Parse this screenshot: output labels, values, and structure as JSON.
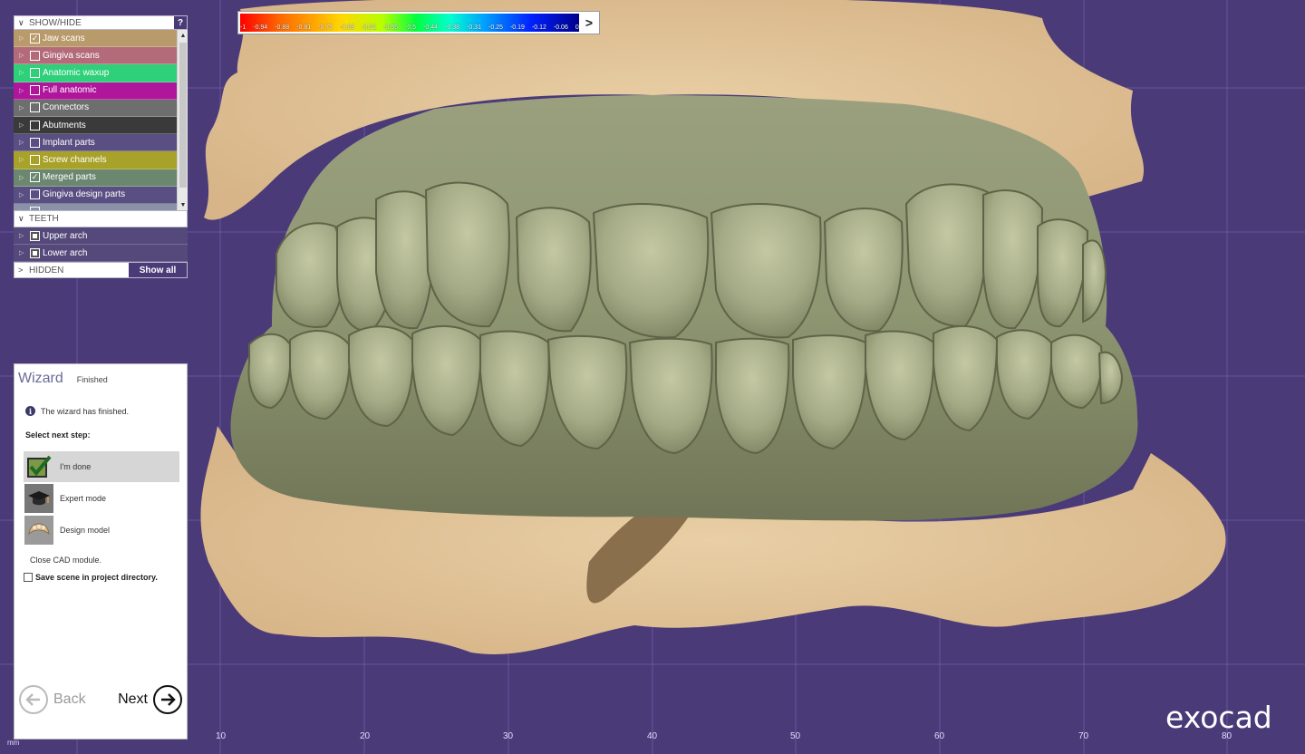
{
  "colorbar": {
    "ticks": [
      "-1",
      "-0.94",
      "-0.88",
      "-0.81",
      "-0.75",
      "-0.69",
      "-0.62",
      "-0.56",
      "-0.5",
      "-0.44",
      "-0.38",
      "-0.31",
      "-0.25",
      "-0.19",
      "-0.12",
      "-0.06",
      "0"
    ],
    "arrow": ">"
  },
  "show_hide": {
    "title": "SHOW/HIDE",
    "help": "?",
    "items": [
      {
        "label": "Jaw scans",
        "checked": true,
        "color": "#b99a6b"
      },
      {
        "label": "Gingiva scans",
        "checked": false,
        "color": "#b36b7a"
      },
      {
        "label": "Anatomic waxup",
        "checked": false,
        "color": "#2fd07a"
      },
      {
        "label": "Full anatomic",
        "checked": false,
        "color": "#b0169c"
      },
      {
        "label": "Connectors",
        "checked": false,
        "color": "#6e6e6e"
      },
      {
        "label": "Abutments",
        "checked": false,
        "color": "#3a3a3a"
      },
      {
        "label": "Implant parts",
        "checked": false,
        "color": "#5a4f82"
      },
      {
        "label": "Screw channels",
        "checked": false,
        "color": "#a8a22a"
      },
      {
        "label": "Merged parts",
        "checked": true,
        "color": "#6c8770"
      },
      {
        "label": "Gingiva design parts",
        "checked": false,
        "color": "#5a4f82"
      },
      {
        "label": "",
        "checked": false,
        "color": "#8a92a8"
      }
    ]
  },
  "teeth": {
    "title": "TEETH",
    "items": [
      {
        "label": "Upper arch"
      },
      {
        "label": "Lower arch"
      }
    ]
  },
  "hidden": {
    "title": "HIDDEN",
    "show_all": "Show all"
  },
  "wizard": {
    "title": "Wizard",
    "status": "Finished",
    "info": "The wizard has finished.",
    "select_label": "Select next step:",
    "options": [
      {
        "label": "I'm done",
        "icon": "checkmark-icon",
        "selected": true
      },
      {
        "label": "Expert mode",
        "icon": "graduation-cap-icon",
        "selected": false
      },
      {
        "label": "Design model",
        "icon": "jaw-model-icon",
        "selected": false
      }
    ],
    "close_text": "Close CAD module.",
    "save_label": "Save scene in project directory.",
    "save_checked": false,
    "back": "Back",
    "next": "Next"
  },
  "axis": {
    "labels": [
      "10",
      "20",
      "30",
      "40",
      "50",
      "60",
      "70",
      "80"
    ],
    "unit": "mm"
  },
  "brand": "exocad",
  "colors": {
    "background": "#4a3a78",
    "accent": "#4a3a78"
  }
}
